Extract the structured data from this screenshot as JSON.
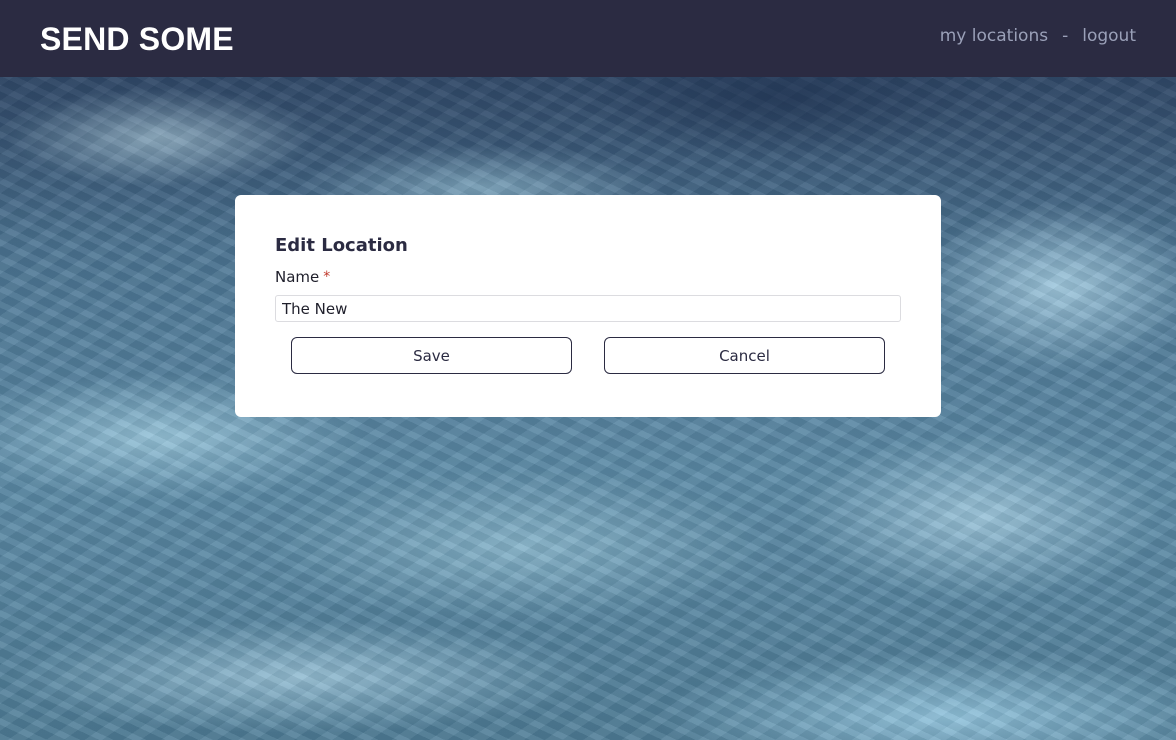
{
  "header": {
    "brand": "SEND SOME",
    "nav": {
      "my_locations": "my locations",
      "separator": "-",
      "logout": "logout"
    }
  },
  "form": {
    "title": "Edit Location",
    "name_label": "Name",
    "required_marker": "*",
    "name_value": "The New",
    "save_label": "Save",
    "cancel_label": "Cancel"
  },
  "colors": {
    "header_bg": "#2b2b42",
    "nav_link": "#9aa0b8",
    "required": "#c0392b"
  }
}
